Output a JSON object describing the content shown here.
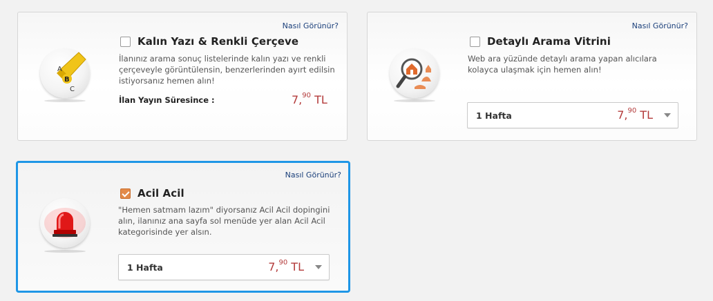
{
  "cards": [
    {
      "how_label": "Nasıl Görünür?",
      "title": "Kalın Yazı & Renkli Çerçeve",
      "checked": false,
      "description": "İlanınız arama sonuç listelerinde kalın yazı ve renkli çerçeveyle görüntülensin, benzerlerinden ayırt edilsin istiyorsanız hemen alın!",
      "duration_label": "İlan Yayın Süresince :",
      "price_main": "7,",
      "price_sup": "90",
      "price_unit": " TL",
      "icon": "abc-highlighter-icon"
    },
    {
      "how_label": "Nasıl Görünür?",
      "title": "Detaylı Arama Vitrini",
      "checked": false,
      "description": "Web ara yüzünde detaylı arama yapan alıcılara kolayca ulaşmak için hemen alın!",
      "select_value": "1 Hafta",
      "price_main": "7,",
      "price_sup": "90",
      "price_unit": " TL",
      "icon": "magnifier-house-icon"
    },
    {
      "how_label": "Nasıl Görünür?",
      "title": "Acil Acil",
      "checked": true,
      "description": "\"Hemen satmam lazım\" diyorsanız Acil Acil dopingini alın, ilanınız ana sayfa sol menüde yer alan Acil Acil kategorisinde yer alsın.",
      "select_value": "1 Hafta",
      "price_main": "7,",
      "price_sup": "90",
      "price_unit": " TL",
      "icon": "siren-light-icon"
    }
  ],
  "colors": {
    "accent_selected": "#1e96e6",
    "price": "#b33a3a",
    "checkbox_checked": "#e38a49",
    "link": "#1a3f7a"
  }
}
